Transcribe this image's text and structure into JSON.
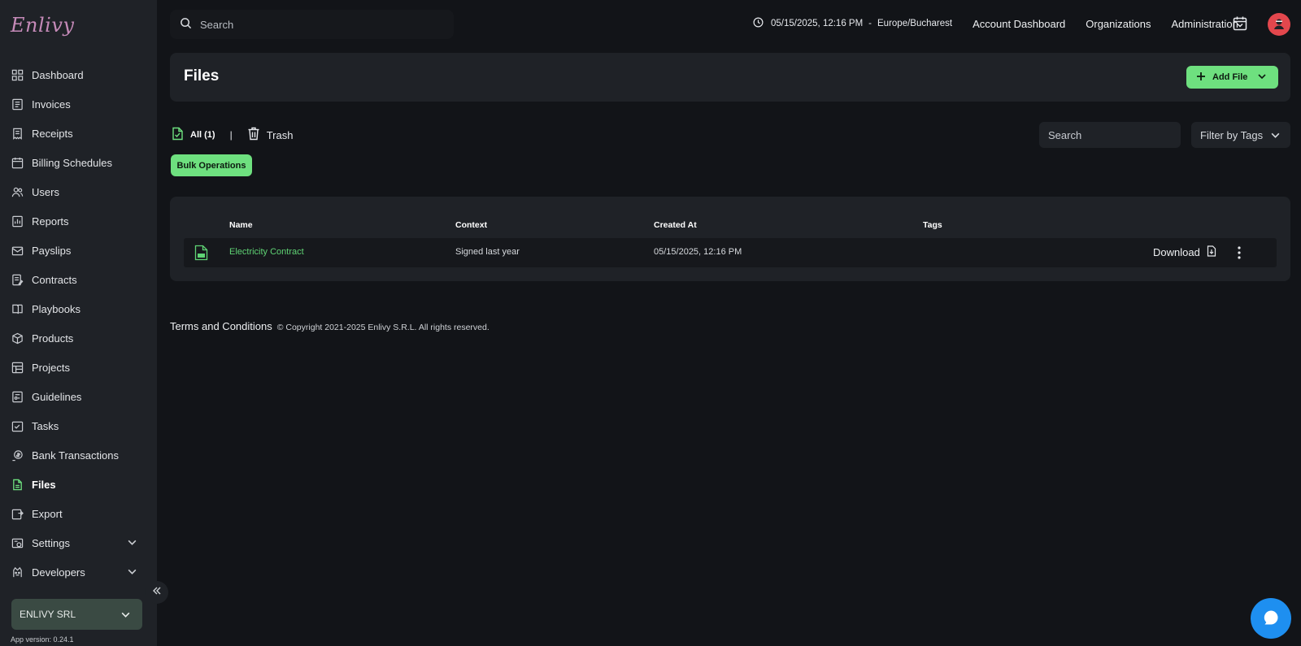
{
  "app": {
    "logo_text": "Enlivy",
    "version_label": "App version: 0.24.1"
  },
  "sidebar": {
    "items": [
      {
        "label": "Dashboard",
        "icon": "dashboard-icon"
      },
      {
        "label": "Invoices",
        "icon": "invoice-icon"
      },
      {
        "label": "Receipts",
        "icon": "receipt-icon"
      },
      {
        "label": "Billing Schedules",
        "icon": "billing-schedule-icon"
      },
      {
        "label": "Users",
        "icon": "users-icon"
      },
      {
        "label": "Reports",
        "icon": "reports-icon"
      },
      {
        "label": "Payslips",
        "icon": "payslips-icon"
      },
      {
        "label": "Contracts",
        "icon": "contracts-icon"
      },
      {
        "label": "Playbooks",
        "icon": "playbooks-icon"
      },
      {
        "label": "Products",
        "icon": "products-icon"
      },
      {
        "label": "Projects",
        "icon": "projects-icon"
      },
      {
        "label": "Guidelines",
        "icon": "guidelines-icon"
      },
      {
        "label": "Tasks",
        "icon": "tasks-icon"
      },
      {
        "label": "Bank Transactions",
        "icon": "bank-transactions-icon"
      },
      {
        "label": "Files",
        "icon": "files-icon",
        "active": true
      },
      {
        "label": "Export",
        "icon": "export-icon"
      },
      {
        "label": "Settings",
        "icon": "settings-icon",
        "expandable": true
      },
      {
        "label": "Developers",
        "icon": "developers-icon",
        "expandable": true
      }
    ],
    "org_name": "ENLIVY SRL"
  },
  "topbar": {
    "search_placeholder": "Search",
    "datetime": "05/15/2025, 12:16 PM",
    "separator": "-",
    "timezone": "Europe/Bucharest",
    "links": [
      "Account Dashboard",
      "Organizations",
      "Administration"
    ]
  },
  "page": {
    "title": "Files",
    "add_button_label": "Add File",
    "tabs": {
      "all_label": "All (1)",
      "separator": "|",
      "trash_label": "Trash"
    },
    "bulk_label": "Bulk Operations",
    "filter_search_placeholder": "Search",
    "filter_tags_label": "Filter by Tags"
  },
  "table": {
    "columns": [
      "Name",
      "Context",
      "Created At",
      "Tags"
    ],
    "rows": [
      {
        "name": "Electricity Contract",
        "context": "Signed last year",
        "created_at": "05/15/2025, 12:16 PM",
        "tags": "",
        "action_label": "Download"
      }
    ]
  },
  "footer": {
    "terms_label": "Terms and Conditions",
    "copyright": "© Copyright 2021-2025 Enlivy S.R.L. All rights reserved."
  },
  "colors": {
    "accent": "#6ee07f",
    "link": "#5fd374",
    "sidebar_bg": "#1f2227",
    "page_bg": "#121418",
    "chat": "#1e8ff0",
    "avatar": "#e3474d"
  }
}
